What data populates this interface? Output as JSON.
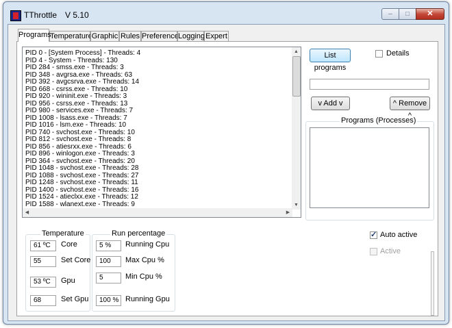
{
  "window": {
    "title": "TThrottle",
    "version": "V 5.10",
    "controls": {
      "minimize": "–",
      "maximize": "□",
      "close": "✕"
    }
  },
  "tabs": [
    {
      "label": "Programs",
      "active": true
    },
    {
      "label": "Temperature",
      "active": false
    },
    {
      "label": "Graphic",
      "active": false
    },
    {
      "label": "Rules",
      "active": false
    },
    {
      "label": "Preference",
      "active": false
    },
    {
      "label": "Logging",
      "active": false
    },
    {
      "label": "Expert",
      "active": false
    }
  ],
  "processes": [
    "PID 0 - [System Process] - Threads: 4",
    "PID 4 - System - Threads: 130",
    "PID 284 - smss.exe - Threads: 3",
    "PID 348 - avgrsa.exe - Threads: 63",
    "PID 392 - avgcsrva.exe - Threads: 14",
    "PID 668 - csrss.exe - Threads: 10",
    "PID 920 - wininit.exe - Threads: 3",
    "PID 956 - csrss.exe - Threads: 13",
    "PID 980 - services.exe - Threads: 7",
    "PID 1008 - lsass.exe - Threads: 7",
    "PID 1016 - lsm.exe - Threads: 10",
    "PID 740 - svchost.exe - Threads: 10",
    "PID 812 - svchost.exe - Threads: 8",
    "PID 856 - atiesrxx.exe - Threads: 6",
    "PID 896 - winlogon.exe - Threads: 3",
    "PID 364 - svchost.exe - Threads: 20",
    "PID 1048 - svchost.exe - Threads: 28",
    "PID 1088 - svchost.exe - Threads: 27",
    "PID 1248 - svchost.exe - Threads: 11",
    "PID 1400 - svchost.exe - Threads: 16",
    "PID 1524 - atieclxx.exe - Threads: 12",
    "PID 1588 - wlanext.exe - Threads: 9"
  ],
  "scroll_icons": {
    "up": "▲",
    "down": "▼",
    "left": "◀",
    "right": "▶"
  },
  "right_panel": {
    "list_programs_label": "List programs",
    "details_label": "Details",
    "details_checked": false,
    "program_input_value": "",
    "add_label": "v Add v",
    "remove_label": "^ Remove ^",
    "programs_group_title": "Programs (Processes)"
  },
  "temperature": {
    "group_title": "Temperature",
    "core_value": "61 ºC",
    "core_label": "Core",
    "set_core_value": "55",
    "set_core_label": "Set Core",
    "gpu_value": "53 ºC",
    "gpu_label": "Gpu",
    "set_gpu_value": "68",
    "set_gpu_label": "Set Gpu"
  },
  "run_percentage": {
    "group_title": "Run percentage",
    "running_cpu_value": "5 %",
    "running_cpu_label": "Running Cpu",
    "max_cpu_value": "100",
    "max_cpu_label": "Max Cpu %",
    "min_cpu_value": "5",
    "min_cpu_label": "Min Cpu %",
    "running_gpu_value": "100 %",
    "running_gpu_label": "Running Gpu"
  },
  "options": {
    "auto_active_label": "Auto active",
    "auto_active_checked": true,
    "active_label": "Active",
    "active_checked": false
  }
}
